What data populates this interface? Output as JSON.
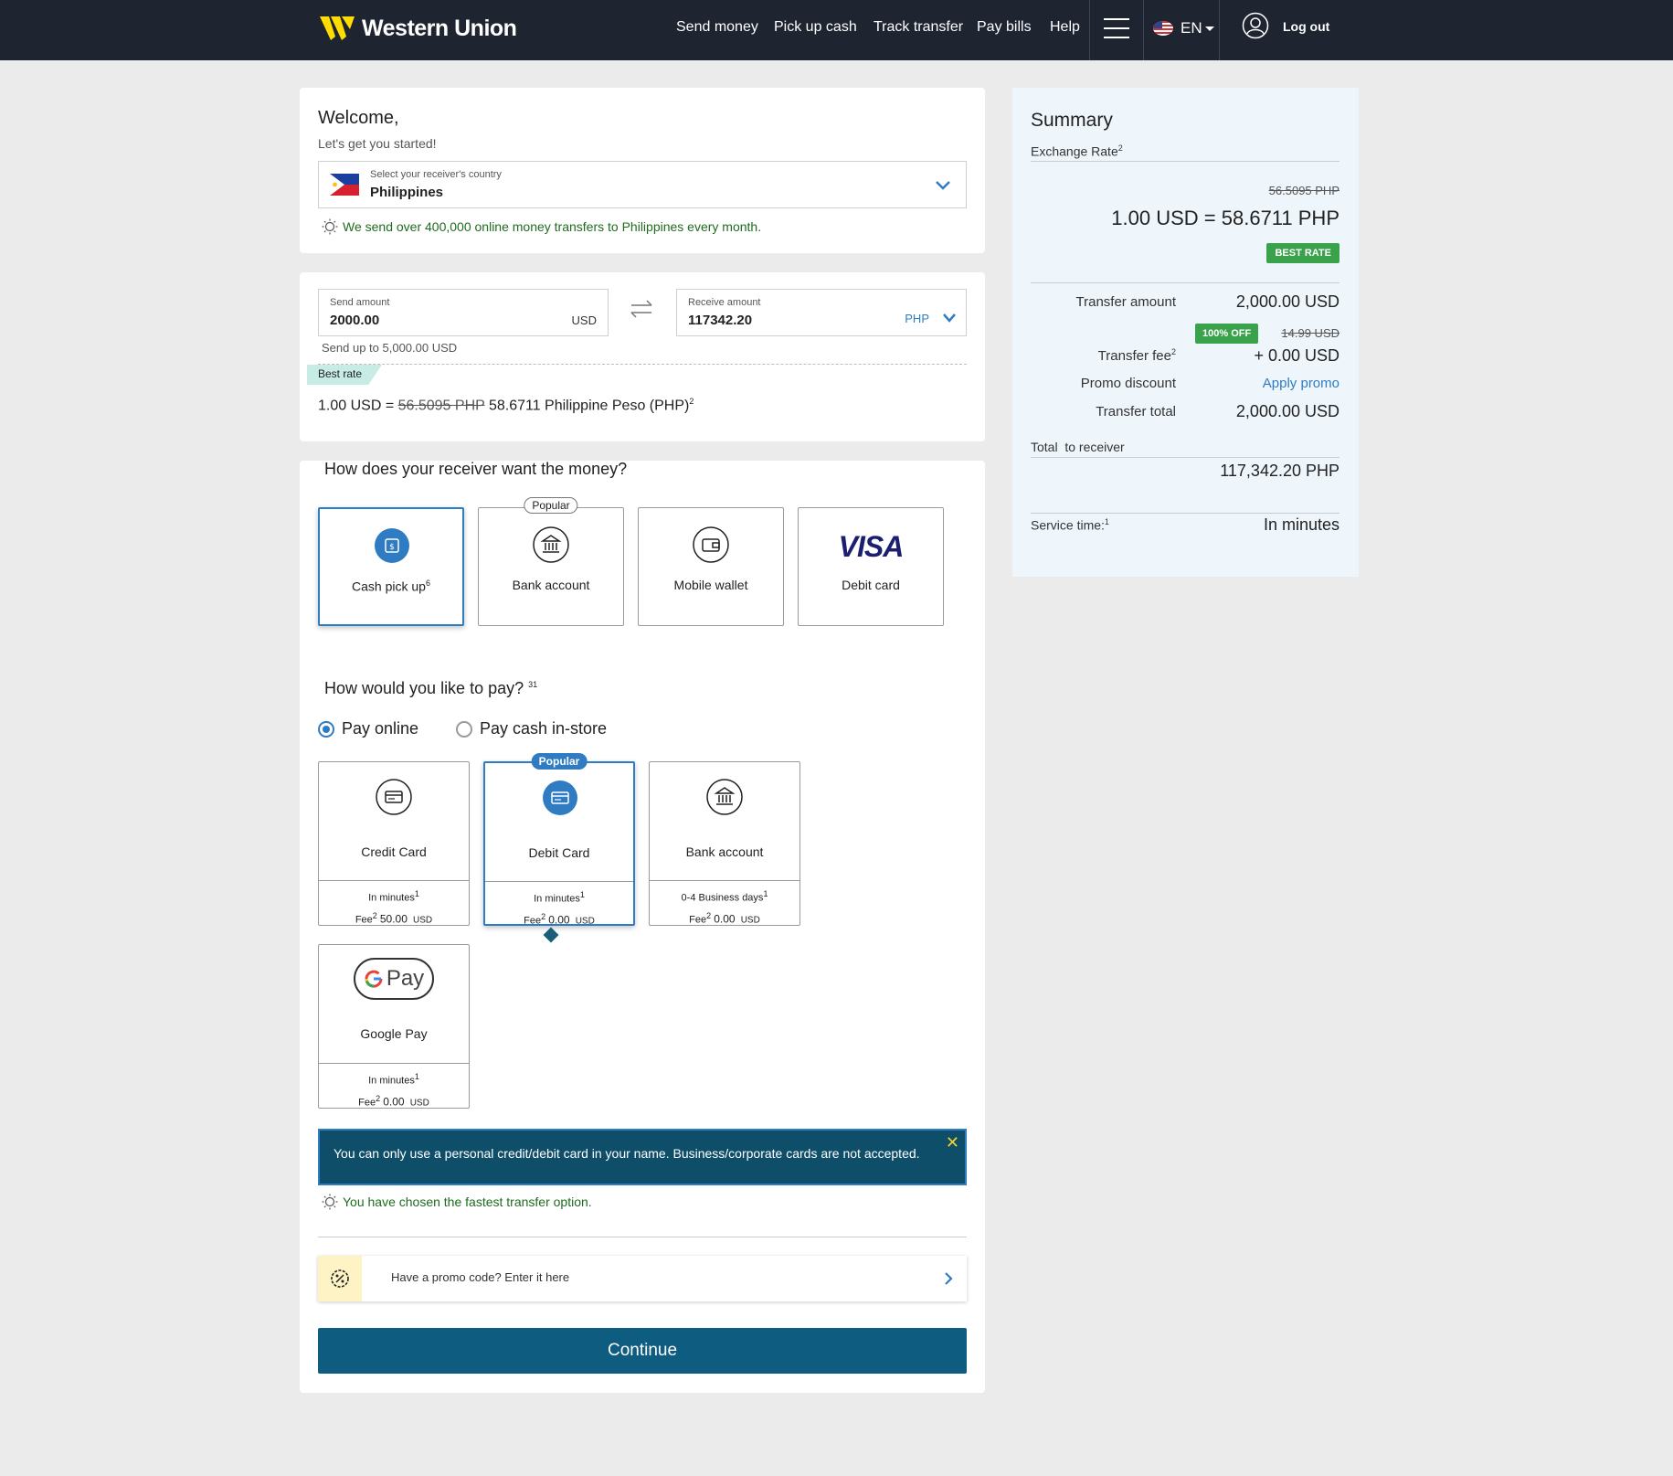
{
  "nav": {
    "brand": "Western Union",
    "links": [
      "Send money",
      "Pick up cash",
      "Track transfer",
      "Pay bills",
      "Help"
    ],
    "language": "EN",
    "logout": "Log out"
  },
  "welcome": {
    "title": "Welcome,",
    "subtitle": "Let's get you started!",
    "country_label": "Select your receiver's country",
    "country_value": "Philippines",
    "tip": "We send over 400,000 online money transfers to Philippines every month."
  },
  "amounts": {
    "send_label": "Send amount",
    "send_value": "2000.00",
    "send_currency": "USD",
    "receive_label": "Receive amount",
    "receive_value": "117342.20",
    "receive_currency": "PHP",
    "send_limit": "Send up to 5,000.00 USD",
    "best_rate_tag": "Best rate",
    "rate_prefix": "1.00 USD =",
    "rate_old": "56.5095 PHP",
    "rate_new": "58.6711 Philippine Peso (PHP)",
    "rate_sup": "2"
  },
  "receive_method": {
    "title": "How does your receiver want the money?",
    "popular_label": "Popular",
    "options": [
      {
        "label": "Cash pick up",
        "sup": "6",
        "icon": "cash-pickup-icon"
      },
      {
        "label": "Bank account",
        "icon": "bank-icon"
      },
      {
        "label": "Mobile wallet",
        "icon": "wallet-icon"
      },
      {
        "label": "Debit card",
        "icon": "visa-logo",
        "logo_text": "VISA"
      }
    ]
  },
  "pay_method": {
    "title": "How would you like to pay?",
    "title_sup": "31",
    "radios": [
      "Pay online",
      "Pay cash in-store"
    ],
    "popular_label": "Popular",
    "options": [
      {
        "label": "Credit Card",
        "speed": "In minutes",
        "fee_prefix": "Fee",
        "fee": "50.00",
        "currency": "USD",
        "icon": "credit-card-icon"
      },
      {
        "label": "Debit Card",
        "speed": "In minutes",
        "fee_prefix": "Fee",
        "fee": "0.00",
        "currency": "USD",
        "icon": "debit-card-icon"
      },
      {
        "label": "Bank account",
        "speed": "0-4 Business days",
        "fee_prefix": "Fee",
        "fee": "0.00",
        "currency": "USD",
        "icon": "bank-icon"
      },
      {
        "label": "Google Pay",
        "speed": "In minutes",
        "fee_prefix": "Fee",
        "fee": "0.00",
        "currency": "USD",
        "icon": "google-pay-logo",
        "logo_text": "Pay"
      }
    ]
  },
  "notice": {
    "text": "You can only use a personal credit/debit card in your name. Business/corporate cards are not accepted.",
    "close": "✕"
  },
  "fastest_tip": "You have chosen the fastest transfer option.",
  "promo_text": "Have a promo code? Enter it here",
  "continue_label": "Continue",
  "summary": {
    "title": "Summary",
    "exchange_rate_label": "Exchange Rate",
    "exchange_rate_sup": "2",
    "old_rate": "56.5095 PHP",
    "rate": "1.00 USD = 58.6711 PHP",
    "best_rate_badge": "BEST RATE",
    "transfer_amount_label": "Transfer amount",
    "transfer_amount": "2,000.00 USD",
    "off_badge": "100% OFF",
    "old_fee": "14.99 USD",
    "transfer_fee_label": "Transfer fee",
    "transfer_fee": "+ 0.00 USD",
    "promo_label": "Promo discount",
    "promo_link": "Apply promo",
    "total_label": "Transfer total",
    "total": "2,000.00 USD",
    "to_receiver_label": "Total  to receiver",
    "to_receiver": "117,342.20 PHP",
    "service_label": "Service time:",
    "service_sup": "1",
    "service_value": "In minutes"
  },
  "colors": {
    "nav_bg": "#1e2430",
    "accent_blue": "#2f7cc2",
    "continue_bg": "#0e5d80",
    "notice_bg": "#0e4e68",
    "green_badge": "#3aa24a",
    "brand_yellow": "#ffdd00"
  }
}
